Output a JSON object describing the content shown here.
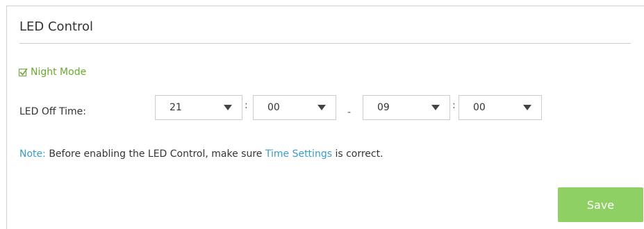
{
  "section": {
    "title": "LED Control"
  },
  "night_mode": {
    "label": "Night Mode",
    "checked": true
  },
  "led_off_time": {
    "label": "LED Off Time:",
    "start_hour": "21",
    "start_minute": "00",
    "end_hour": "09",
    "end_minute": "00",
    "time_separator": ":",
    "range_separator": "-"
  },
  "note": {
    "prefix": "Note:",
    "text_before": "Before enabling the LED Control, make sure",
    "link": "Time Settings",
    "text_after": "is correct."
  },
  "actions": {
    "save_label": "Save"
  },
  "colors": {
    "accent_green": "#6aa830",
    "button_green": "#8ed063",
    "link_blue": "#3a9bc4"
  }
}
